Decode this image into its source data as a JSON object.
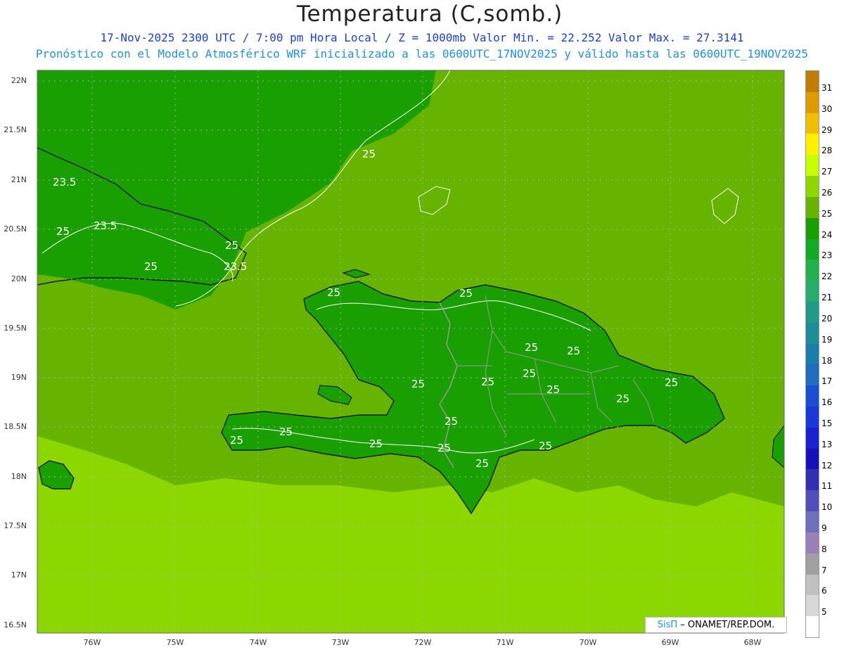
{
  "title": "Temperatura (C,somb.)",
  "subtitle_line1": "17-Nov-2025  2300 UTC / 7:00 pm Hora Local / Z = 1000mb    Valor Min. = 22.252  Valor Max. = 27.3141",
  "subtitle_line2": "Pronóstico con el Modelo Atmosférico WRF inicializado a las 0600UTC_17NOV2025 y válido hasta las  0600UTC_19NOV2025",
  "credit": {
    "brand": "SisΠ",
    "text": " – ONAMET/REP.DOM."
  },
  "lat_labels": [
    "22N",
    "21.5N",
    "21N",
    "20.5N",
    "20N",
    "19.5N",
    "19N",
    "18.5N",
    "18N",
    "17.5N",
    "17N",
    "16.5N"
  ],
  "lon_labels": [
    "76W",
    "75W",
    "74W",
    "73W",
    "72W",
    "71W",
    "70W",
    "69W",
    "68W"
  ],
  "colorbar": {
    "labels": [
      "31",
      "30",
      "29",
      "28",
      "27",
      "26",
      "25",
      "24",
      "23",
      "22",
      "21",
      "20",
      "19",
      "18",
      "17",
      "16",
      "15",
      "13",
      "12",
      "11",
      "10",
      "9",
      "8",
      "7",
      "6",
      "5"
    ],
    "colors": [
      "#c07d00",
      "#de9c00",
      "#f0c000",
      "#fff000",
      "#c8ff00",
      "#8cd700",
      "#66b400",
      "#19a000",
      "#11aa22",
      "#22b14c",
      "#26ad6e",
      "#1f9a86",
      "#1d8e99",
      "#1c7ea8",
      "#1f6cc1",
      "#1a4fd0",
      "#1a37d8",
      "#1a22d0",
      "#1610b8",
      "#3030b0",
      "#5050b8",
      "#7070b8",
      "#9a80b8",
      "#a0a0a0",
      "#c0c0c0",
      "#d8d8d8",
      "#ffffff"
    ]
  },
  "contour_labels": [
    "25",
    "23.5",
    "25",
    "23.5",
    "25",
    "25",
    "23.5",
    "25",
    "25",
    "25",
    "25",
    "25",
    "25",
    "25",
    "25",
    "25",
    "25",
    "25",
    "25",
    "25",
    "25",
    "25",
    "25",
    "25"
  ],
  "colors": {
    "sea_warm": "#8cd700",
    "sea_mid": "#66b400",
    "land_cool": "#19a000",
    "coast": "#000000",
    "border": "#999999",
    "contour": "#ffffff"
  }
}
